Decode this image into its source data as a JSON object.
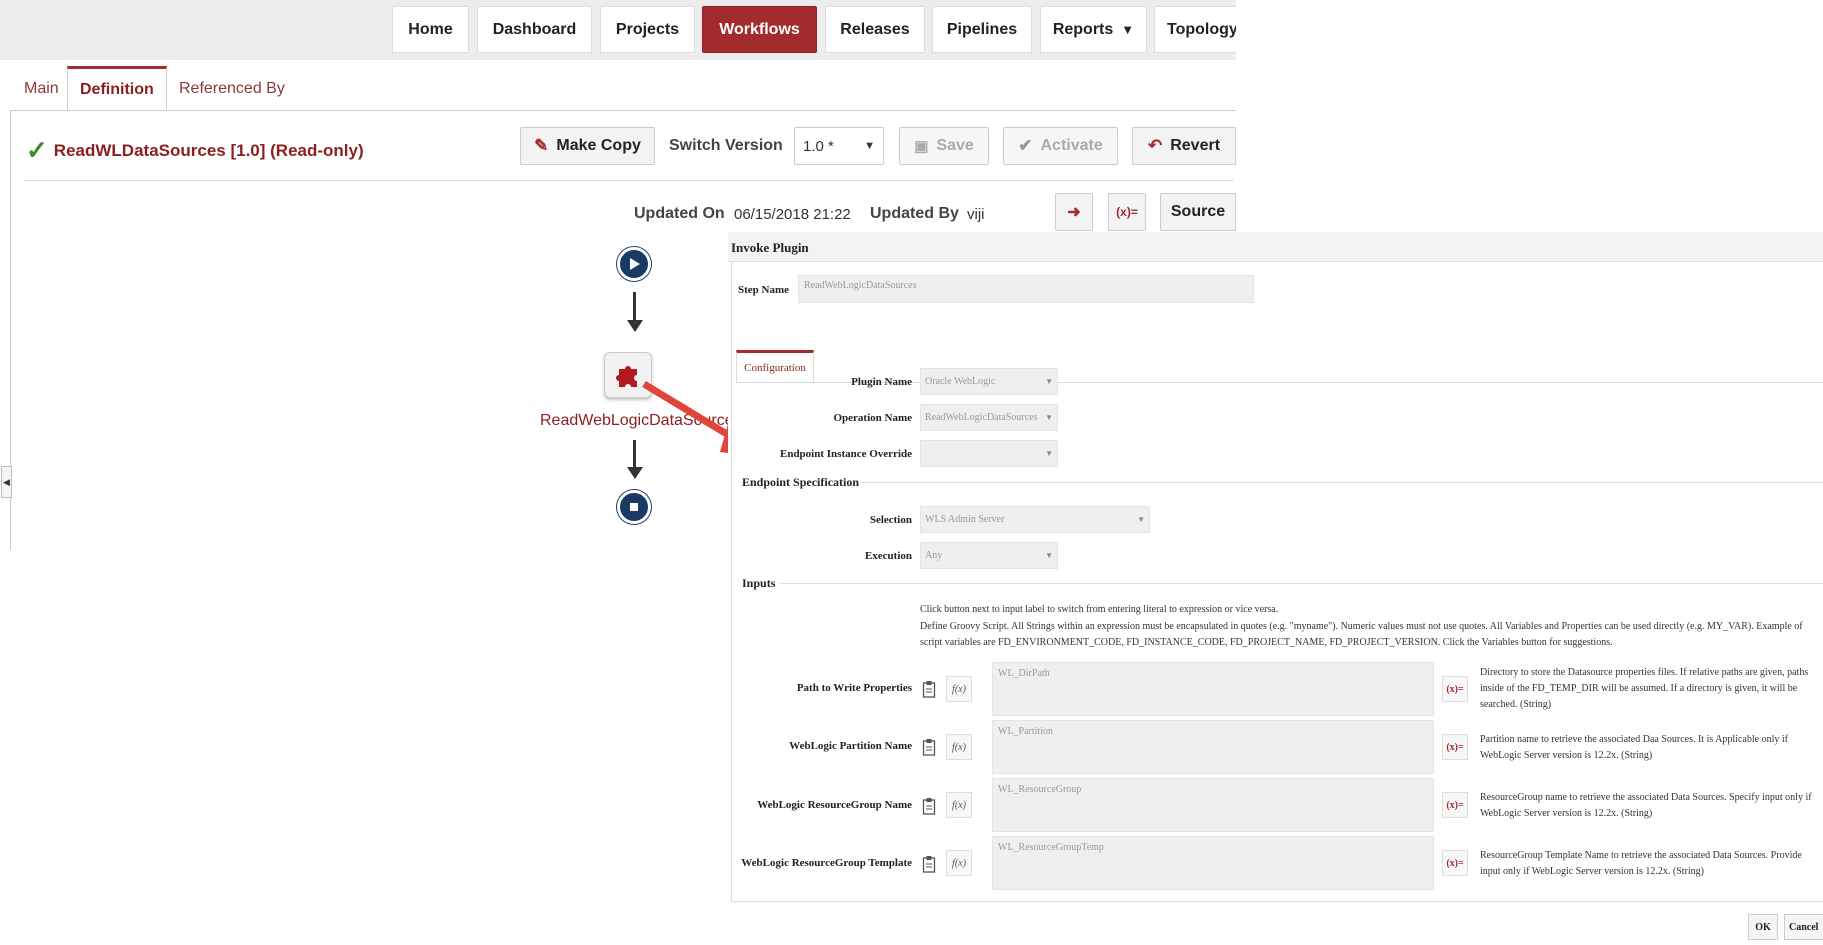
{
  "nav": {
    "items": [
      "Home",
      "Dashboard",
      "Projects",
      "Workflows",
      "Releases",
      "Pipelines",
      "Reports",
      "Topology"
    ],
    "active": "Workflows",
    "reports_caret": "▼"
  },
  "tabs": [
    "Main",
    "Definition",
    "Referenced By"
  ],
  "workflow": {
    "title": "ReadWLDataSources [1.0] (Read-only)",
    "make_copy": "Make Copy",
    "switch_version_label": "Switch Version",
    "version": "1.0 *",
    "save": "Save",
    "activate": "Activate",
    "revert": "Revert",
    "updated_on_label": "Updated On",
    "updated_on": "06/15/2018 21:22",
    "updated_by_label": "Updated By",
    "updated_by": "viji",
    "expr_btn": "(x)=",
    "source": "Source"
  },
  "diagram": {
    "step_label": "ReadWebLogicDataSources"
  },
  "dialog": {
    "title": "Invoke Plugin",
    "step_name_label": "Step Name",
    "step_name_value": "ReadWebLogicDataSources",
    "config_tab": "Configuration",
    "plugin_name_label": "Plugin Name",
    "plugin_name_value": "Oracle WebLogic",
    "operation_name_label": "Operation Name",
    "operation_name_value": "ReadWebLogicDataSources",
    "endpoint_override_label": "Endpoint Instance Override",
    "endpoint_override_value": "",
    "endpoint_spec": "Endpoint Specification",
    "selection_label": "Selection",
    "selection_value": "WLS Admin Server",
    "execution_label": "Execution",
    "execution_value": "Any",
    "inputs": "Inputs",
    "note1": "Click button next to input label to switch from entering literal to expression or vice versa.",
    "note2": "Define Groovy Script. All Strings within an expression must be encapsulated in quotes (e.g. \"myname\"). Numeric values must not use quotes. All Variables and Properties can be used directly (e.g. MY_VAR). Example of script variables are FD_ENVIRONMENT_CODE, FD_INSTANCE_CODE, FD_PROJECT_NAME, FD_PROJECT_VERSION. Click the Variables button for suggestions.",
    "fx": "f(x)",
    "expr": "(x)=",
    "fields": [
      {
        "label": "Path to Write Properties",
        "value": "WL_DirPath",
        "desc": "Directory to store the Datasource properties files. If relative paths are given, paths inside of the FD_TEMP_DIR will be assumed. If a directory is given, it will be searched. (String)"
      },
      {
        "label": "WebLogic Partition Name",
        "value": "WL_Partition",
        "desc": "Partition name to retrieve the associated Daa Sources. It is Applicable only if WebLogic Server version is 12.2x. (String)"
      },
      {
        "label": "WebLogic ResourceGroup Name",
        "value": "WL_ResourceGroup",
        "desc": "ResourceGroup name to retrieve the associated Data Sources. Specify input only if WebLogic Server version is 12.2x. (String)"
      },
      {
        "label": "WebLogic ResourceGroup Template",
        "value": "WL_ResourceGroupTemp",
        "desc": "ResourceGroup Template Name to retrieve the associated Data Sources. Provide input only if WebLogic Server version is 12.2x. (String)"
      }
    ],
    "ok": "OK",
    "cancel": "Cancel"
  },
  "colors": {
    "accent": "#a32b2e",
    "node": "#1a3a63",
    "arrow": "#e0453a"
  },
  "icons": [
    "checkmark-icon",
    "pencil-icon",
    "chevron-down-icon",
    "floppy-icon",
    "check-circle-icon",
    "undo-icon",
    "import-icon",
    "play-icon",
    "puzzle-icon",
    "stop-icon",
    "clipboard-icon"
  ]
}
